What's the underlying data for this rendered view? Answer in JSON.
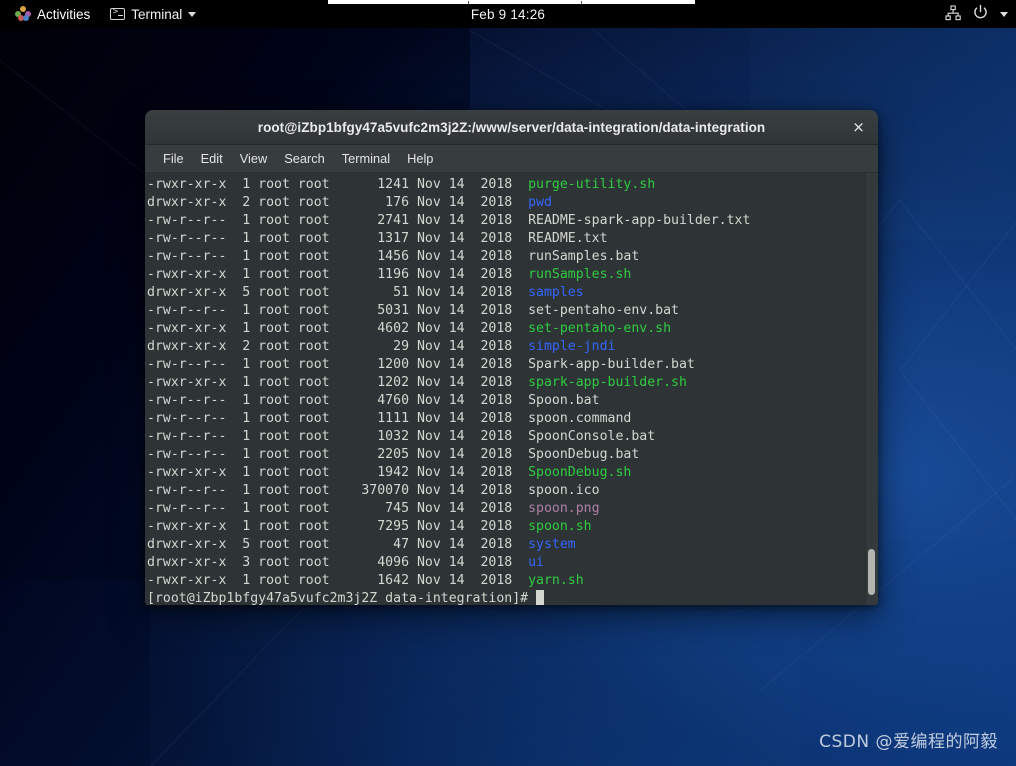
{
  "topbar": {
    "activities_label": "Activities",
    "app_label": "Terminal",
    "clock": "Feb 9  14:26",
    "icons": {
      "gnome": "gnome-logo-icon",
      "terminal": "terminal-icon",
      "app_caret": "chevron-down-icon",
      "network": "network-wired-icon",
      "power": "power-icon",
      "system_caret": "chevron-down-icon"
    }
  },
  "terminal": {
    "title": "root@iZbp1bfgy47a5vufc2m3j2Z:/www/server/data-integration/data-integration",
    "close_label": "×",
    "menu": [
      "File",
      "Edit",
      "View",
      "Search",
      "Terminal",
      "Help"
    ],
    "prompt": "[root@iZbp1bfgy47a5vufc2m3j2Z data-integration]# ",
    "lines": [
      {
        "perms": "-rwxr-xr-x",
        "links": "1",
        "owner": "root",
        "group": "root",
        "size": "1241",
        "month": "Nov",
        "day": "14",
        "year": "2018",
        "name": "purge-utility.sh",
        "color": "green"
      },
      {
        "perms": "drwxr-xr-x",
        "links": "2",
        "owner": "root",
        "group": "root",
        "size": "176",
        "month": "Nov",
        "day": "14",
        "year": "2018",
        "name": "pwd",
        "color": "blue"
      },
      {
        "perms": "-rw-r--r--",
        "links": "1",
        "owner": "root",
        "group": "root",
        "size": "2741",
        "month": "Nov",
        "day": "14",
        "year": "2018",
        "name": "README-spark-app-builder.txt",
        "color": "white"
      },
      {
        "perms": "-rw-r--r--",
        "links": "1",
        "owner": "root",
        "group": "root",
        "size": "1317",
        "month": "Nov",
        "day": "14",
        "year": "2018",
        "name": "README.txt",
        "color": "white"
      },
      {
        "perms": "-rw-r--r--",
        "links": "1",
        "owner": "root",
        "group": "root",
        "size": "1456",
        "month": "Nov",
        "day": "14",
        "year": "2018",
        "name": "runSamples.bat",
        "color": "white"
      },
      {
        "perms": "-rwxr-xr-x",
        "links": "1",
        "owner": "root",
        "group": "root",
        "size": "1196",
        "month": "Nov",
        "day": "14",
        "year": "2018",
        "name": "runSamples.sh",
        "color": "green"
      },
      {
        "perms": "drwxr-xr-x",
        "links": "5",
        "owner": "root",
        "group": "root",
        "size": "51",
        "month": "Nov",
        "day": "14",
        "year": "2018",
        "name": "samples",
        "color": "blue"
      },
      {
        "perms": "-rw-r--r--",
        "links": "1",
        "owner": "root",
        "group": "root",
        "size": "5031",
        "month": "Nov",
        "day": "14",
        "year": "2018",
        "name": "set-pentaho-env.bat",
        "color": "white"
      },
      {
        "perms": "-rwxr-xr-x",
        "links": "1",
        "owner": "root",
        "group": "root",
        "size": "4602",
        "month": "Nov",
        "day": "14",
        "year": "2018",
        "name": "set-pentaho-env.sh",
        "color": "green"
      },
      {
        "perms": "drwxr-xr-x",
        "links": "2",
        "owner": "root",
        "group": "root",
        "size": "29",
        "month": "Nov",
        "day": "14",
        "year": "2018",
        "name": "simple-jndi",
        "color": "blue"
      },
      {
        "perms": "-rw-r--r--",
        "links": "1",
        "owner": "root",
        "group": "root",
        "size": "1200",
        "month": "Nov",
        "day": "14",
        "year": "2018",
        "name": "Spark-app-builder.bat",
        "color": "white"
      },
      {
        "perms": "-rwxr-xr-x",
        "links": "1",
        "owner": "root",
        "group": "root",
        "size": "1202",
        "month": "Nov",
        "day": "14",
        "year": "2018",
        "name": "spark-app-builder.sh",
        "color": "green"
      },
      {
        "perms": "-rw-r--r--",
        "links": "1",
        "owner": "root",
        "group": "root",
        "size": "4760",
        "month": "Nov",
        "day": "14",
        "year": "2018",
        "name": "Spoon.bat",
        "color": "white"
      },
      {
        "perms": "-rw-r--r--",
        "links": "1",
        "owner": "root",
        "group": "root",
        "size": "1111",
        "month": "Nov",
        "day": "14",
        "year": "2018",
        "name": "spoon.command",
        "color": "white"
      },
      {
        "perms": "-rw-r--r--",
        "links": "1",
        "owner": "root",
        "group": "root",
        "size": "1032",
        "month": "Nov",
        "day": "14",
        "year": "2018",
        "name": "SpoonConsole.bat",
        "color": "white"
      },
      {
        "perms": "-rw-r--r--",
        "links": "1",
        "owner": "root",
        "group": "root",
        "size": "2205",
        "month": "Nov",
        "day": "14",
        "year": "2018",
        "name": "SpoonDebug.bat",
        "color": "white"
      },
      {
        "perms": "-rwxr-xr-x",
        "links": "1",
        "owner": "root",
        "group": "root",
        "size": "1942",
        "month": "Nov",
        "day": "14",
        "year": "2018",
        "name": "SpoonDebug.sh",
        "color": "green"
      },
      {
        "perms": "-rw-r--r--",
        "links": "1",
        "owner": "root",
        "group": "root",
        "size": "370070",
        "month": "Nov",
        "day": "14",
        "year": "2018",
        "name": "spoon.ico",
        "color": "white"
      },
      {
        "perms": "-rw-r--r--",
        "links": "1",
        "owner": "root",
        "group": "root",
        "size": "745",
        "month": "Nov",
        "day": "14",
        "year": "2018",
        "name": "spoon.png",
        "color": "magenta"
      },
      {
        "perms": "-rwxr-xr-x",
        "links": "1",
        "owner": "root",
        "group": "root",
        "size": "7295",
        "month": "Nov",
        "day": "14",
        "year": "2018",
        "name": "spoon.sh",
        "color": "green"
      },
      {
        "perms": "drwxr-xr-x",
        "links": "5",
        "owner": "root",
        "group": "root",
        "size": "47",
        "month": "Nov",
        "day": "14",
        "year": "2018",
        "name": "system",
        "color": "blue"
      },
      {
        "perms": "drwxr-xr-x",
        "links": "3",
        "owner": "root",
        "group": "root",
        "size": "4096",
        "month": "Nov",
        "day": "14",
        "year": "2018",
        "name": "ui",
        "color": "blue"
      },
      {
        "perms": "-rwxr-xr-x",
        "links": "1",
        "owner": "root",
        "group": "root",
        "size": "1642",
        "month": "Nov",
        "day": "14",
        "year": "2018",
        "name": "yarn.sh",
        "color": "green"
      }
    ]
  },
  "watermark": "CSDN @爱编程的阿毅",
  "colors": {
    "terminal_bg": "#2e3436",
    "terminal_fg": "#d3d7cf",
    "dir_color": "#3465ff",
    "exec_color": "#4e9a06",
    "image_color": "#ad7fa8",
    "titlebar_bg": "#31383a",
    "topbar_bg": "#000000"
  }
}
